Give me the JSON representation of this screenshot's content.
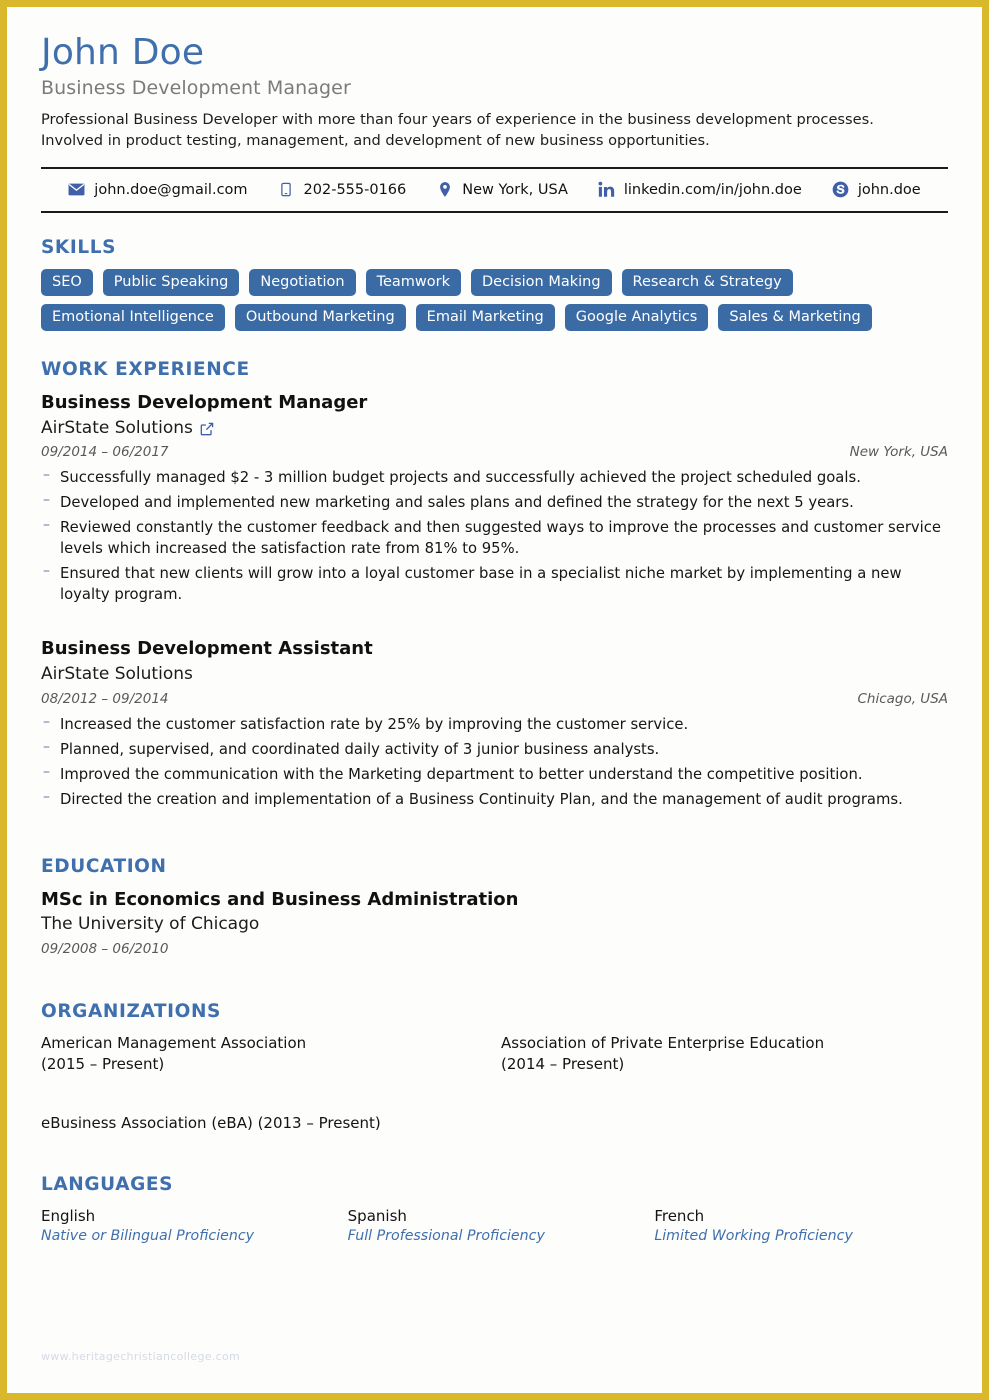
{
  "header": {
    "name": "John Doe",
    "job_title": "Business Development Manager",
    "summary": "Professional Business Developer with more than four years of experience in the business development processes. Involved in product testing, management, and development of new business opportunities."
  },
  "contact": {
    "items": [
      {
        "icon": "email-icon",
        "value": "john.doe@gmail.com"
      },
      {
        "icon": "phone-icon",
        "value": "202-555-0166"
      },
      {
        "icon": "location-pin-icon",
        "value": "New York, USA"
      },
      {
        "icon": "linkedin-icon",
        "value": "linkedin.com/in/john.doe"
      },
      {
        "icon": "skype-icon",
        "value": "john.doe"
      }
    ]
  },
  "skills": {
    "title": "SKILLS",
    "items": [
      "SEO",
      "Public Speaking",
      "Negotiation",
      "Teamwork",
      "Decision Making",
      "Research & Strategy",
      "Emotional Intelligence",
      "Outbound Marketing",
      "Email Marketing",
      "Google Analytics",
      "Sales & Marketing"
    ]
  },
  "work_experience": {
    "title": "WORK EXPERIENCE",
    "jobs": [
      {
        "role": "Business Development Manager",
        "company": "AirState Solutions",
        "has_link": true,
        "dates": "09/2014 – 06/2017",
        "location": "New York, USA",
        "bullets": [
          "Successfully managed $2 - 3 million budget projects and successfully achieved the project scheduled goals.",
          "Developed and implemented new marketing and sales plans and defined the strategy for the next 5 years.",
          "Reviewed constantly the customer feedback and then suggested ways to improve the processes and customer service levels which increased the satisfaction rate from 81% to 95%.",
          "Ensured that new clients will grow into a loyal customer base in a specialist niche market by implementing a new loyalty program."
        ]
      },
      {
        "role": "Business Development Assistant",
        "company": "AirState Solutions",
        "has_link": false,
        "dates": "08/2012 – 09/2014",
        "location": "Chicago, USA",
        "bullets": [
          "Increased the customer satisfaction rate by 25% by improving the customer service.",
          "Planned, supervised, and coordinated daily activity of 3 junior business analysts.",
          "Improved the communication with the Marketing department to better understand the competitive position.",
          "Directed the creation and implementation of a Business Continuity Plan, and the management of audit programs."
        ]
      }
    ]
  },
  "education": {
    "title": "EDUCATION",
    "entries": [
      {
        "degree": "MSc in Economics and Business Administration",
        "school": "The University of Chicago",
        "dates": "09/2008 – 06/2010"
      }
    ]
  },
  "organizations": {
    "title": "ORGANIZATIONS",
    "items": [
      "American Management Association\n(2015 – Present)",
      "Association of Private Enterprise Education\n(2014 – Present)",
      "eBusiness Association (eBA) (2013 – Present)"
    ]
  },
  "languages": {
    "title": "LANGUAGES",
    "items": [
      {
        "name": "English",
        "level": "Native or Bilingual Proficiency"
      },
      {
        "name": "Spanish",
        "level": "Full Professional Proficiency"
      },
      {
        "name": "French",
        "level": "Limited Working Proficiency"
      }
    ]
  },
  "watermark": "www.heritagechristiancollege.com",
  "colors": {
    "accent_blue": "#3f6fad",
    "pill_blue": "#3b6ba5",
    "border_gold": "#d9b82c",
    "icon_blue": "#3f5fa8"
  }
}
